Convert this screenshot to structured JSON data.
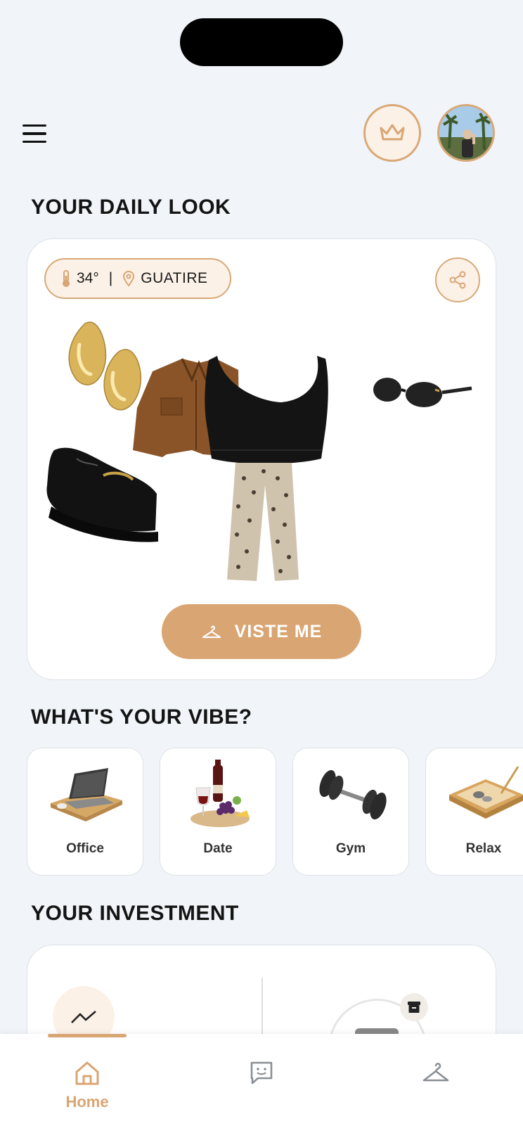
{
  "header": {
    "menu_icon": "hamburger-menu-icon",
    "premium_icon": "crown-icon",
    "avatar_icon": "user-avatar"
  },
  "daily_look": {
    "title": "YOUR DAILY LOOK",
    "temperature": "34°",
    "separator": "|",
    "location": "GUATIRE",
    "share_icon": "share-icon",
    "button_label": "VISTE ME",
    "items": [
      "earrings",
      "jacket",
      "crop-top",
      "sunglasses",
      "loafers",
      "leopard-pants"
    ]
  },
  "vibes": {
    "title": "WHAT'S YOUR VIBE?",
    "items": [
      {
        "label": "Office"
      },
      {
        "label": "Date"
      },
      {
        "label": "Gym"
      },
      {
        "label": "Relax"
      }
    ]
  },
  "investment": {
    "title": "YOUR INVESTMENT"
  },
  "bottom_nav": {
    "items": [
      {
        "label": "Home",
        "icon": "home-icon",
        "active": true
      },
      {
        "label": "",
        "icon": "chat-icon",
        "active": false
      },
      {
        "label": "",
        "icon": "hanger-icon",
        "active": false
      }
    ]
  },
  "colors": {
    "accent": "#d9a573",
    "accent_light": "#fbf1e6",
    "background": "#f1f4f8"
  }
}
